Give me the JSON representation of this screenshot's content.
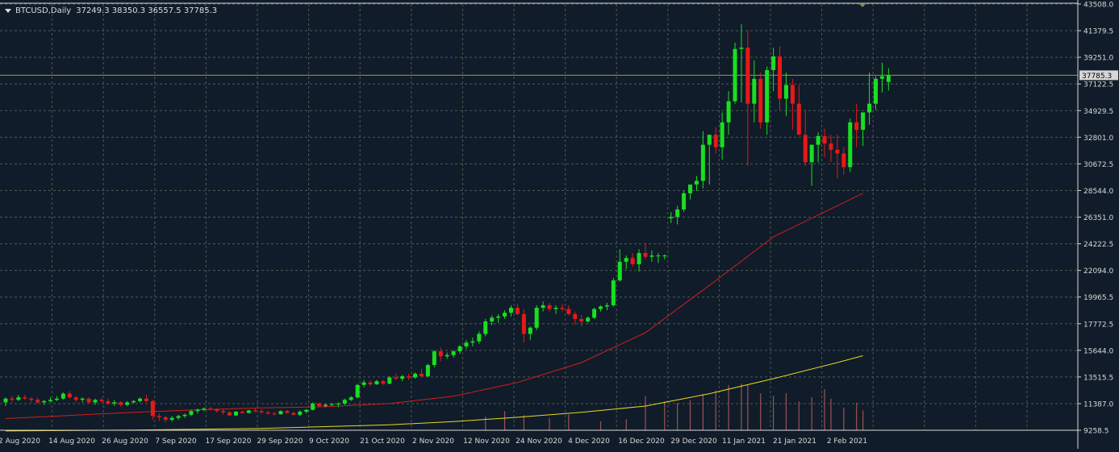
{
  "header": {
    "symbol_label": "BTCUSD,Daily",
    "ohlc": "37249.3 38350.3 36557.5 37785.3"
  },
  "colors": {
    "background": "#101c29",
    "grid": "#4c5a53",
    "axis": "#d8d8d8",
    "bull": "#18e020",
    "bear": "#e81818",
    "ma_fast": "#d21e1e",
    "ma_slow": "#e8d820",
    "volume": "#a05252",
    "price_line": "#9a9a42",
    "price_label_bg": "#d6d6d6"
  },
  "chart_data": {
    "type": "candlestick",
    "symbol": "BTCUSD",
    "timeframe": "Daily",
    "current_price": 37785.3,
    "current_price_label": "37785.3",
    "ylim": [
      9258.5,
      43508.0
    ],
    "y_ticks": [
      "43508.0",
      "41379.5",
      "39251.0",
      "37122.5",
      "34929.5",
      "32801.0",
      "30672.5",
      "28544.0",
      "26351.0",
      "24222.5",
      "22094.0",
      "19965.5",
      "17772.5",
      "15644.0",
      "13515.5",
      "11387.0",
      "9258.5"
    ],
    "x_ticks": [
      "2 Aug 2020",
      "14 Aug 2020",
      "26 Aug 2020",
      "7 Sep 2020",
      "17 Sep 2020",
      "29 Sep 2020",
      "9 Oct 2020",
      "21 Oct 2020",
      "2 Nov 2020",
      "12 Nov 2020",
      "24 Nov 2020",
      "4 Dec 2020",
      "16 Dec 2020",
      "29 Dec 2020",
      "11 Jan 2021",
      "21 Jan 2021",
      "2 Feb 2021"
    ],
    "ohlc": [
      [
        11500,
        11900,
        11200,
        11800
      ],
      [
        11800,
        12000,
        11500,
        11700
      ],
      [
        11700,
        12100,
        11600,
        11900
      ],
      [
        11900,
        12100,
        11700,
        11800
      ],
      [
        11800,
        11900,
        11500,
        11700
      ],
      [
        11700,
        11900,
        11400,
        11500
      ],
      [
        11500,
        11700,
        11300,
        11600
      ],
      [
        11600,
        11900,
        11500,
        11700
      ],
      [
        11700,
        12000,
        11600,
        11800
      ],
      [
        11800,
        12300,
        11700,
        12200
      ],
      [
        12200,
        12400,
        11800,
        11900
      ],
      [
        11900,
        12000,
        11500,
        11700
      ],
      [
        11700,
        11900,
        11500,
        11800
      ],
      [
        11800,
        11900,
        11400,
        11500
      ],
      [
        11500,
        11800,
        11300,
        11700
      ],
      [
        11700,
        11850,
        11450,
        11600
      ],
      [
        11600,
        11800,
        11300,
        11400
      ],
      [
        11400,
        11700,
        11200,
        11500
      ],
      [
        11500,
        11600,
        11150,
        11300
      ],
      [
        11300,
        11600,
        11200,
        11500
      ],
      [
        11500,
        11700,
        11400,
        11600
      ],
      [
        11600,
        11900,
        11500,
        11800
      ],
      [
        11800,
        12100,
        11500,
        11600
      ],
      [
        11600,
        11700,
        10100,
        10400
      ],
      [
        10400,
        10600,
        10000,
        10300
      ],
      [
        10300,
        10400,
        9900,
        10100
      ],
      [
        10100,
        10400,
        9950,
        10250
      ],
      [
        10250,
        10500,
        10100,
        10400
      ],
      [
        10400,
        10600,
        10250,
        10500
      ],
      [
        10500,
        10900,
        10400,
        10800
      ],
      [
        10800,
        11000,
        10600,
        10900
      ],
      [
        10900,
        11100,
        10800,
        11000
      ],
      [
        11000,
        11150,
        10850,
        10950
      ],
      [
        10950,
        11000,
        10700,
        10800
      ],
      [
        10800,
        10950,
        10500,
        10700
      ],
      [
        10700,
        10800,
        10400,
        10450
      ],
      [
        10450,
        10800,
        10400,
        10750
      ],
      [
        10750,
        10850,
        10600,
        10650
      ],
      [
        10650,
        10900,
        10600,
        10850
      ],
      [
        10850,
        11000,
        10700,
        10800
      ],
      [
        10800,
        10950,
        10600,
        10700
      ],
      [
        10700,
        10800,
        10500,
        10600
      ],
      [
        10600,
        10750,
        10450,
        10550
      ],
      [
        10550,
        10850,
        10500,
        10800
      ],
      [
        10800,
        10900,
        10600,
        10650
      ],
      [
        10650,
        10750,
        10450,
        10500
      ],
      [
        10500,
        10850,
        10400,
        10750
      ],
      [
        10750,
        10950,
        10600,
        10900
      ],
      [
        10900,
        11500,
        10850,
        11400
      ],
      [
        11400,
        11500,
        11100,
        11200
      ],
      [
        11200,
        11400,
        11100,
        11300
      ],
      [
        11300,
        11450,
        11200,
        11350
      ],
      [
        11350,
        11500,
        11100,
        11400
      ],
      [
        11400,
        11800,
        11300,
        11700
      ],
      [
        11700,
        12000,
        11600,
        11900
      ],
      [
        11900,
        13000,
        11800,
        12900
      ],
      [
        12900,
        13300,
        12700,
        13100
      ],
      [
        13100,
        13250,
        12800,
        12950
      ],
      [
        12950,
        13300,
        12900,
        13200
      ],
      [
        13200,
        13300,
        12900,
        13000
      ],
      [
        13000,
        13600,
        12950,
        13500
      ],
      [
        13500,
        13800,
        13300,
        13400
      ],
      [
        13400,
        13700,
        13200,
        13600
      ],
      [
        13600,
        13800,
        13300,
        13500
      ],
      [
        13500,
        13900,
        13400,
        13800
      ],
      [
        13800,
        14200,
        13500,
        13600
      ],
      [
        13600,
        14600,
        13500,
        14500
      ],
      [
        14500,
        15700,
        14300,
        15600
      ],
      [
        15600,
        15900,
        14800,
        15200
      ],
      [
        15200,
        15500,
        15000,
        15300
      ],
      [
        15300,
        15700,
        15100,
        15600
      ],
      [
        15600,
        16100,
        15400,
        16000
      ],
      [
        16000,
        16500,
        15800,
        16300
      ],
      [
        16300,
        16700,
        16000,
        16400
      ],
      [
        16400,
        17200,
        16200,
        17000
      ],
      [
        17000,
        18200,
        16800,
        18000
      ],
      [
        18000,
        18500,
        17700,
        18300
      ],
      [
        18300,
        18600,
        17900,
        18400
      ],
      [
        18400,
        18900,
        18200,
        18700
      ],
      [
        18700,
        19300,
        18400,
        19100
      ],
      [
        19100,
        19400,
        18500,
        18600
      ],
      [
        18600,
        19000,
        16300,
        17000
      ],
      [
        17000,
        17600,
        16500,
        17500
      ],
      [
        17500,
        19300,
        17300,
        19100
      ],
      [
        19100,
        19600,
        18800,
        19300
      ],
      [
        19300,
        19500,
        18800,
        19000
      ],
      [
        19000,
        19300,
        18600,
        19100
      ],
      [
        19100,
        19400,
        18800,
        19000
      ],
      [
        19000,
        19300,
        18500,
        18600
      ],
      [
        18600,
        18800,
        17700,
        18200
      ],
      [
        18200,
        18500,
        17600,
        18000
      ],
      [
        18000,
        18400,
        17900,
        18300
      ],
      [
        18300,
        19100,
        18200,
        19000
      ],
      [
        19000,
        19300,
        18800,
        19200
      ],
      [
        19200,
        19500,
        18900,
        19300
      ],
      [
        19300,
        21500,
        19200,
        21300
      ],
      [
        21300,
        23800,
        21200,
        22800
      ],
      [
        22800,
        23300,
        22200,
        23100
      ],
      [
        23100,
        23500,
        22400,
        22600
      ],
      [
        22600,
        23800,
        22000,
        23500
      ],
      [
        23500,
        24300,
        23000,
        23200
      ],
      [
        23200,
        23700,
        22800,
        23300
      ],
      [
        23300,
        23500,
        22700,
        23300
      ],
      [
        23300,
        23400,
        23000,
        23300
      ],
      [
        26300,
        26800,
        25900,
        26400
      ],
      [
        26400,
        27300,
        25800,
        27000
      ],
      [
        27000,
        28500,
        26800,
        28300
      ],
      [
        28300,
        29000,
        27800,
        29000
      ],
      [
        29000,
        29700,
        28500,
        29300
      ],
      [
        29300,
        33300,
        28700,
        32200
      ],
      [
        32200,
        33000,
        29000,
        33000
      ],
      [
        33000,
        33600,
        31500,
        32000
      ],
      [
        32000,
        34800,
        31000,
        34000
      ],
      [
        34000,
        36500,
        33000,
        35700
      ],
      [
        35700,
        40400,
        35500,
        39900
      ],
      [
        39900,
        41900,
        35600,
        40000
      ],
      [
        40000,
        41400,
        30500,
        35500
      ],
      [
        35500,
        39000,
        34000,
        37500
      ],
      [
        37500,
        38000,
        33500,
        34000
      ],
      [
        34000,
        38500,
        33000,
        38200
      ],
      [
        38200,
        40000,
        36500,
        39300
      ],
      [
        39300,
        40100,
        35000,
        35900
      ],
      [
        35900,
        38000,
        34500,
        37000
      ],
      [
        37000,
        37500,
        33400,
        35500
      ],
      [
        35500,
        37000,
        33000,
        33000
      ],
      [
        33000,
        35000,
        30500,
        30800
      ],
      [
        30800,
        31500,
        28900,
        32200
      ],
      [
        32200,
        33200,
        30800,
        32900
      ],
      [
        32900,
        33500,
        31200,
        32300
      ],
      [
        32300,
        33000,
        30800,
        31800
      ],
      [
        31800,
        33000,
        29500,
        31500
      ],
      [
        31500,
        32000,
        29800,
        30400
      ],
      [
        30400,
        34300,
        30000,
        34000
      ],
      [
        34000,
        35500,
        32000,
        33400
      ],
      [
        33400,
        34800,
        32100,
        34800
      ],
      [
        34800,
        38000,
        33800,
        35500
      ],
      [
        35500,
        37700,
        35000,
        37500
      ],
      [
        37500,
        38800,
        36400,
        37700
      ],
      [
        37249.3,
        38350.3,
        36557.5,
        37785.3
      ]
    ],
    "series": [
      {
        "name": "",
        "type": "line",
        "color": "#d21e1e",
        "points": [
          [
            0,
            10200
          ],
          [
            10,
            10450
          ],
          [
            20,
            10700
          ],
          [
            30,
            10900
          ],
          [
            40,
            11050
          ],
          [
            50,
            11150
          ],
          [
            60,
            11400
          ],
          [
            70,
            12000
          ],
          [
            80,
            13100
          ],
          [
            90,
            14700
          ],
          [
            100,
            17100
          ],
          [
            110,
            20900
          ],
          [
            120,
            24800
          ],
          [
            130,
            27300
          ],
          [
            134,
            28300
          ]
        ]
      },
      {
        "name": "",
        "type": "line",
        "color": "#e8d820",
        "points": [
          [
            0,
            9200
          ],
          [
            20,
            9280
          ],
          [
            40,
            9400
          ],
          [
            60,
            9700
          ],
          [
            70,
            9950
          ],
          [
            80,
            10300
          ],
          [
            90,
            10700
          ],
          [
            100,
            11200
          ],
          [
            110,
            12200
          ],
          [
            120,
            13400
          ],
          [
            130,
            14700
          ],
          [
            134,
            15250
          ]
        ]
      }
    ],
    "volume_bars": [
      [
        75,
        2.0
      ],
      [
        78,
        2.8
      ],
      [
        81,
        2.2
      ],
      [
        85,
        1.8
      ],
      [
        88,
        2.3
      ],
      [
        93,
        1.3
      ],
      [
        97,
        1.6
      ],
      [
        100,
        5.0
      ],
      [
        103,
        4.2
      ],
      [
        105,
        4.0
      ],
      [
        107,
        4.4
      ],
      [
        109,
        5.3
      ],
      [
        111,
        5.8
      ],
      [
        113,
        6.6
      ],
      [
        115,
        6.8
      ],
      [
        116,
        6.6
      ],
      [
        118,
        5.4
      ],
      [
        120,
        5.0
      ],
      [
        122,
        5.4
      ],
      [
        124,
        4.2
      ],
      [
        126,
        4.8
      ],
      [
        128,
        6.0
      ],
      [
        129,
        4.6
      ],
      [
        131,
        3.3
      ],
      [
        133,
        4.0
      ],
      [
        134,
        2.9
      ]
    ]
  }
}
